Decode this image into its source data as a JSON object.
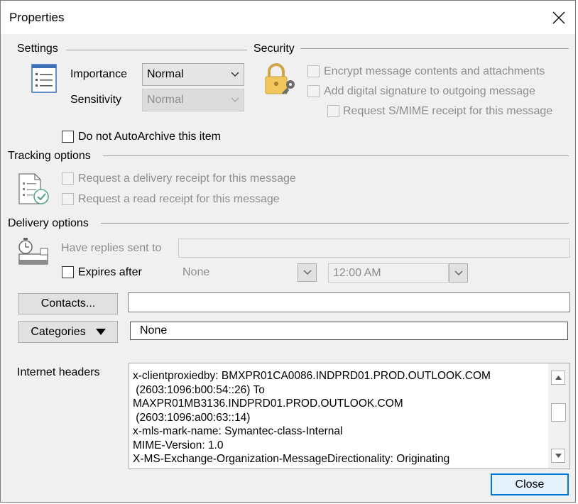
{
  "window": {
    "title": "Properties"
  },
  "settings": {
    "header": "Settings",
    "importance_label": "Importance",
    "importance_value": "Normal",
    "sensitivity_label": "Sensitivity",
    "sensitivity_value": "Normal",
    "autoarchive_label": "Do not AutoArchive this item",
    "autoarchive_checked": false
  },
  "security": {
    "header": "Security",
    "encrypt_label": "Encrypt message contents and attachments",
    "signature_label": "Add digital signature to outgoing message",
    "smime_label": "Request S/MIME receipt for this message"
  },
  "tracking": {
    "header": "Tracking options",
    "delivery_receipt_label": "Request a delivery receipt for this message",
    "read_receipt_label": "Request a read receipt for this message"
  },
  "delivery": {
    "header": "Delivery options",
    "replies_label": "Have replies sent to",
    "replies_value": "",
    "expires_label": "Expires after",
    "expires_date": "None",
    "expires_time": "12:00 AM"
  },
  "contacts": {
    "button_label": "Contacts...",
    "value": ""
  },
  "categories": {
    "button_label": "Categories",
    "value": "None"
  },
  "internet_headers": {
    "label": "Internet headers",
    "lines": [
      "x-clientproxiedby: BMXPR01CA0086.INDPRD01.PROD.OUTLOOK.COM",
      " (2603:1096:b00:54::26) To",
      "MAXPR01MB3136.INDPRD01.PROD.OUTLOOK.COM",
      " (2603:1096:a00:63::14)",
      "x-mls-mark-name: Symantec-class-Internal",
      "MIME-Version: 1.0",
      "X-MS-Exchange-Organization-MessageDirectionality: Originating"
    ]
  },
  "footer": {
    "close_label": "Close"
  },
  "icons": {
    "settings": "list-icon",
    "security": "padlock-key-icon",
    "tracking": "tracking-checklist-icon",
    "delivery": "clock-envelope-icon"
  },
  "colors": {
    "accent": "#0078d7",
    "disabled_text": "#8d8d8d",
    "dialog_bg": "#f0f0f0"
  }
}
